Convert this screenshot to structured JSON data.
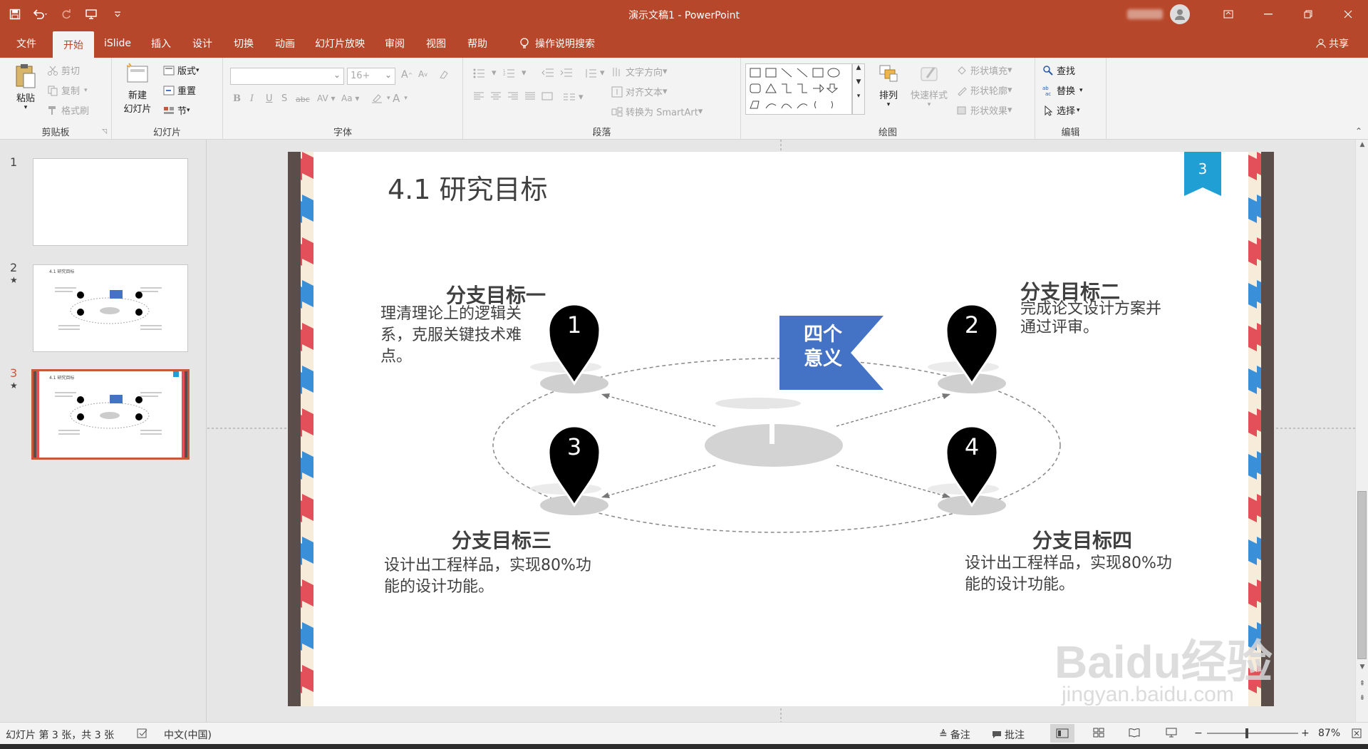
{
  "app": {
    "window_title": "演示文稿1 - PowerPoint",
    "share_label": "共享"
  },
  "tabs": [
    "文件",
    "开始",
    "iSlide",
    "插入",
    "设计",
    "切换",
    "动画",
    "幻灯片放映",
    "审阅",
    "视图",
    "帮助"
  ],
  "tell_me": "操作说明搜索",
  "ribbon": {
    "clipboard": {
      "label": "剪贴板",
      "paste": "粘贴",
      "cut": "剪切",
      "copy": "复制",
      "format_painter": "格式刷"
    },
    "slides": {
      "label": "幻灯片",
      "new_slide_1": "新建",
      "new_slide_2": "幻灯片",
      "layout": "版式",
      "reset": "重置",
      "section": "节"
    },
    "font": {
      "label": "字体",
      "font_size": "16+"
    },
    "paragraph": {
      "label": "段落",
      "text_direction": "文字方向",
      "align_text": "对齐文本",
      "smartart": "转换为 SmartArt"
    },
    "drawing": {
      "label": "绘图",
      "arrange": "排列",
      "quick_styles": "快速样式",
      "shape_fill": "形状填充",
      "shape_outline": "形状轮廓",
      "shape_effects": "形状效果"
    },
    "editing": {
      "label": "编辑",
      "find": "查找",
      "replace": "替换",
      "select": "选择"
    }
  },
  "thumbnails": [
    {
      "num": "1"
    },
    {
      "num": "2"
    },
    {
      "num": "3"
    }
  ],
  "slide": {
    "title": "4.1 研究目标",
    "page_badge": "3",
    "flag_line1": "四个",
    "flag_line2": "意义",
    "goals": [
      {
        "num": "1",
        "title": "分支目标一",
        "lines": [
          "理清理论上的逻辑关",
          "系，克服关键技术难",
          "点。"
        ]
      },
      {
        "num": "2",
        "title": "分支目标二",
        "lines": [
          "完成论文设计方案并",
          "通过评审。"
        ]
      },
      {
        "num": "3",
        "title": "分支目标三",
        "lines": [
          "设计出工程样品，实现80%功",
          "能的设计功能。"
        ]
      },
      {
        "num": "4",
        "title": "分支目标四",
        "lines": [
          "设计出工程样品，实现80%功",
          "能的设计功能。"
        ]
      }
    ]
  },
  "thumb_title": "4.1 研究目标",
  "watermark": {
    "brand": "Baidu经验",
    "url": "jingyan.baidu.com"
  },
  "status": {
    "slide_info": "幻灯片 第 3 张，共 3 张",
    "language": "中文(中国)",
    "notes": "备注",
    "comments": "批注",
    "zoom": "87%"
  },
  "colors": {
    "accent": "#b7472a",
    "flag": "#4472c4",
    "badge": "#1f9fd4"
  }
}
